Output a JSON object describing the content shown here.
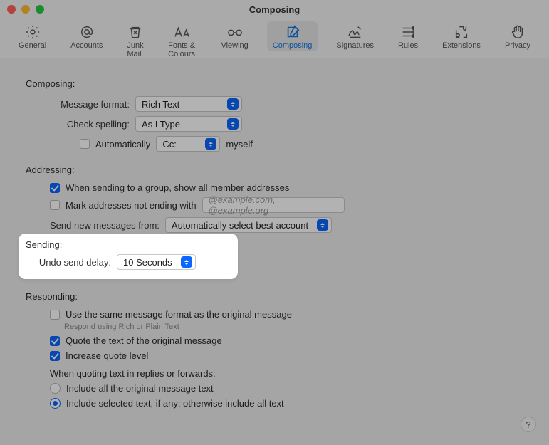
{
  "window": {
    "title": "Composing"
  },
  "toolbar": {
    "items": [
      {
        "id": "general",
        "label": "General"
      },
      {
        "id": "accounts",
        "label": "Accounts"
      },
      {
        "id": "junk",
        "label": "Junk Mail"
      },
      {
        "id": "fonts",
        "label": "Fonts & Colours"
      },
      {
        "id": "viewing",
        "label": "Viewing"
      },
      {
        "id": "composing",
        "label": "Composing"
      },
      {
        "id": "signatures",
        "label": "Signatures"
      },
      {
        "id": "rules",
        "label": "Rules"
      },
      {
        "id": "extensions",
        "label": "Extensions"
      },
      {
        "id": "privacy",
        "label": "Privacy"
      }
    ],
    "active_id": "composing"
  },
  "composing": {
    "header": "Composing:",
    "message_format_label": "Message format:",
    "message_format_value": "Rich Text",
    "check_spelling_label": "Check spelling:",
    "check_spelling_value": "As I Type",
    "auto_cc_checkbox": "Automatically",
    "auto_cc_checked": false,
    "auto_cc_select": "Cc:",
    "auto_cc_suffix": "myself"
  },
  "addressing": {
    "header": "Addressing:",
    "group_checkbox": "When sending to a group, show all member addresses",
    "group_checked": true,
    "mark_checkbox": "Mark addresses not ending with",
    "mark_checked": false,
    "mark_placeholder": "@example.com, @example.org",
    "send_from_label": "Send new messages from:",
    "send_from_value": "Automatically select best account"
  },
  "sending": {
    "header": "Sending:",
    "undo_label": "Undo send delay:",
    "undo_value": "10 Seconds"
  },
  "responding": {
    "header": "Responding:",
    "same_format_checkbox": "Use the same message format as the original message",
    "same_format_checked": false,
    "same_format_note": "Respond using Rich or Plain Text",
    "quote_text_checkbox": "Quote the text of the original message",
    "quote_text_checked": true,
    "increase_quote_checkbox": "Increase quote level",
    "increase_quote_checked": true,
    "when_quoting_label": "When quoting text in replies or forwards:",
    "include_all_radio": "Include all the original message text",
    "include_all_selected": false,
    "include_selected_radio": "Include selected text, if any; otherwise include all text",
    "include_selected_selected": true
  },
  "help_button": "?"
}
